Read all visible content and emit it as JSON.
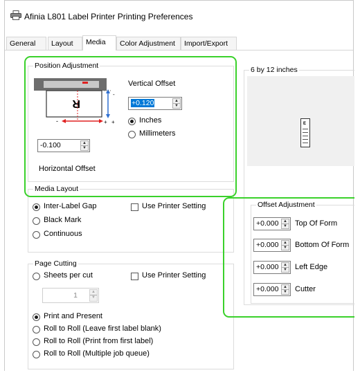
{
  "window": {
    "title": "Afinia L801 Label Printer Printing Preferences"
  },
  "tabs": [
    {
      "label": "General"
    },
    {
      "label": "Layout"
    },
    {
      "label": "Media",
      "active": true
    },
    {
      "label": "Color Adjustment"
    },
    {
      "label": "Import/Export"
    }
  ],
  "position_adjustment": {
    "legend": "Position Adjustment",
    "vertical_offset_label": "Vertical Offset",
    "vertical_offset_value": "+0.120",
    "units": {
      "inches": "Inches",
      "millimeters": "Millimeters",
      "selected": "inches"
    },
    "horizontal_offset_value": "-0.100",
    "horizontal_offset_label": "Horizontal Offset"
  },
  "media_size_preview": {
    "legend": "6 by 12 inches",
    "icon": "label-roll-icon"
  },
  "media_layout": {
    "legend": "Media Layout",
    "options": [
      {
        "label": "Inter-Label Gap",
        "selected": true
      },
      {
        "label": "Black Mark",
        "selected": false
      },
      {
        "label": "Continuous",
        "selected": false
      }
    ],
    "use_printer_setting": {
      "label": "Use Printer Setting",
      "checked": false
    }
  },
  "offset_adjustment": {
    "legend": "Offset Adjustment",
    "rows": [
      {
        "value": "+0.000",
        "label": "Top Of Form"
      },
      {
        "value": "+0.000",
        "label": "Bottom Of Form"
      },
      {
        "value": "+0.000",
        "label": "Left Edge"
      },
      {
        "value": "+0.000",
        "label": "Cutter"
      }
    ]
  },
  "page_cutting": {
    "legend": "Page Cutting",
    "sheets_per_cut_label": "Sheets per cut",
    "sheets_per_cut_value": "1",
    "use_printer_setting": {
      "label": "Use Printer Setting",
      "checked": false
    },
    "options": [
      {
        "label": "Print and Present",
        "selected": true
      },
      {
        "label": "Roll to Roll (Leave first label blank)",
        "selected": false
      },
      {
        "label": "Roll to Roll (Print from first label)",
        "selected": false
      },
      {
        "label": "Roll to Roll (Multiple job queue)",
        "selected": false
      }
    ]
  },
  "colors": {
    "highlight": "#39d12a",
    "selection": "#0078d7",
    "arrow_red": "#e02020"
  }
}
